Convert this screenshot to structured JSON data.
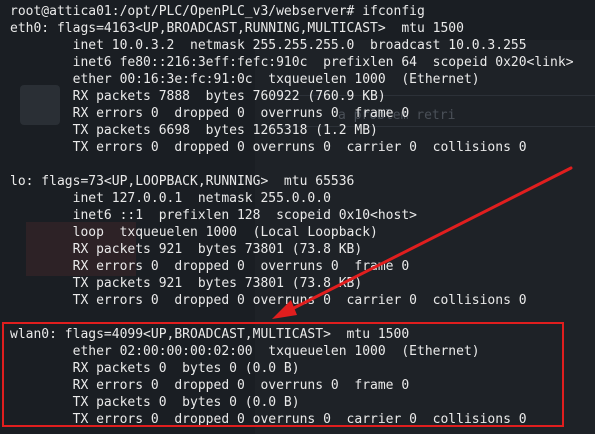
{
  "theme": {
    "background": "#14171b",
    "text_color": "#eaeaea",
    "annotation_color": "#e01e1e"
  },
  "background": {
    "ghost_text": "a problem retri"
  },
  "terminal": {
    "prompt": "root@attica01:/opt/PLC/OpenPLC_v3/webserver#",
    "command": "ifconfig",
    "lines": [
      "eth0: flags=4163<UP,BROADCAST,RUNNING,MULTICAST>  mtu 1500",
      "        inet 10.0.3.2  netmask 255.255.255.0  broadcast 10.0.3.255",
      "        inet6 fe80::216:3eff:fefc:910c  prefixlen 64  scopeid 0x20<link>",
      "        ether 00:16:3e:fc:91:0c  txqueuelen 1000  (Ethernet)",
      "        RX packets 7888  bytes 760922 (760.9 KB)",
      "        RX errors 0  dropped 0  overruns 0  frame 0",
      "        TX packets 6698  bytes 1265318 (1.2 MB)",
      "        TX errors 0  dropped 0 overruns 0  carrier 0  collisions 0",
      "",
      "lo: flags=73<UP,LOOPBACK,RUNNING>  mtu 65536",
      "        inet 127.0.0.1  netmask 255.0.0.0",
      "        inet6 ::1  prefixlen 128  scopeid 0x10<host>",
      "        loop  txqueuelen 1000  (Local Loopback)",
      "        RX packets 921  bytes 73801 (73.8 KB)",
      "        RX errors 0  dropped 0  overruns 0  frame 0",
      "        TX packets 921  bytes 73801 (73.8 KB)",
      "        TX errors 0  dropped 0 overruns 0  carrier 0  collisions 0",
      "",
      "wlan0: flags=4099<UP,BROADCAST,MULTICAST>  mtu 1500",
      "        ether 02:00:00:00:02:00  txqueuelen 1000  (Ethernet)",
      "        RX packets 0  bytes 0 (0.0 B)",
      "        RX errors 0  dropped 0  overruns 0  frame 0",
      "        TX packets 0  bytes 0 (0.0 B)",
      "        TX errors 0  dropped 0 overruns 0  carrier 0  collisions 0"
    ]
  }
}
